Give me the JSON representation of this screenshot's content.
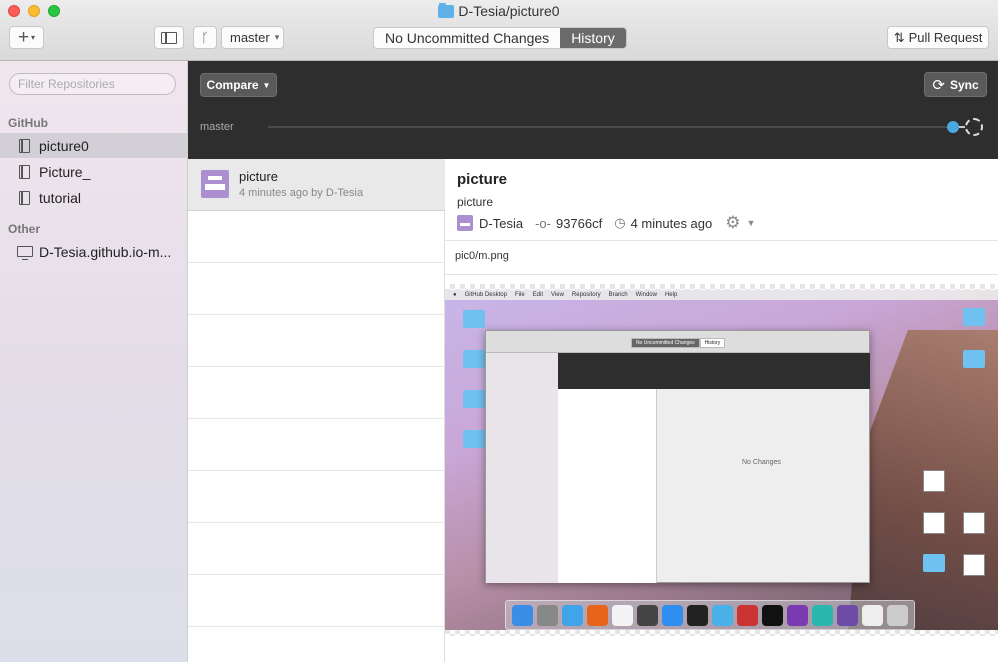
{
  "window": {
    "title": "D-Tesia/picture0"
  },
  "toolbar": {
    "add_label": "+",
    "branch_label": "master",
    "tabs": [
      {
        "label": "No Uncommitted Changes",
        "active": false
      },
      {
        "label": "History",
        "active": true
      }
    ],
    "pull_request_label": "Pull Request"
  },
  "sidebar": {
    "filter_placeholder": "Filter Repositories",
    "groups": [
      {
        "label": "GitHub",
        "items": [
          {
            "label": "picture0",
            "selected": true
          },
          {
            "label": "Picture_",
            "selected": false
          },
          {
            "label": "tutorial",
            "selected": false
          }
        ]
      },
      {
        "label": "Other",
        "items": [
          {
            "label": "D-Tesia.github.io-m...",
            "selected": false
          }
        ]
      }
    ]
  },
  "header": {
    "compare_label": "Compare",
    "sync_label": "Sync",
    "timeline_branch": "master"
  },
  "commits": [
    {
      "title": "picture",
      "meta": "4 minutes ago by D-Tesia",
      "selected": true
    }
  ],
  "detail": {
    "title": "picture",
    "description": "picture",
    "author": "D-Tesia",
    "sha": "93766cf",
    "time": "4 minutes ago",
    "file_path": "pic0/m.png",
    "preview": {
      "menubar": [
        "GitHub Desktop",
        "File",
        "Edit",
        "View",
        "Repository",
        "Branch",
        "Window",
        "Help"
      ],
      "tabs": [
        "No Uncommitted Changes",
        "History"
      ],
      "no_changes_text": "No Changes"
    }
  },
  "colors": {
    "accent_blue": "#4aa8e0",
    "dark_bar": "#2e2e2e",
    "avatar_purple": "#ab8fcf"
  }
}
